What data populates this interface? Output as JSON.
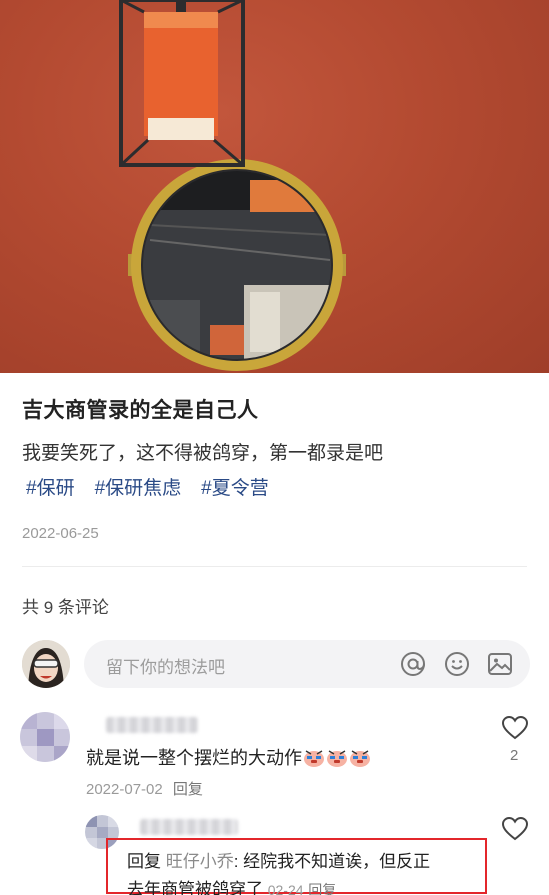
{
  "post": {
    "title": "吉大商管录的全是自己人",
    "text": "我要笑死了，这不得被鸽穿，第一都录是吧",
    "tags": [
      "#保研",
      "#保研焦虑",
      "#夏令营"
    ],
    "date": "2022-06-25"
  },
  "comments_section": {
    "count_label": "共 9 条评论",
    "input_placeholder": "留下你的想法吧",
    "input_icons": [
      "at-icon",
      "emoji-icon",
      "image-icon"
    ]
  },
  "comments": [
    {
      "text": "就是说一整个摆烂的大动作",
      "emoji": "crying-face-icon",
      "date": "2022-07-02",
      "reply_label": "回复",
      "likes": "2"
    }
  ],
  "reply": {
    "prefix": "回复",
    "target_user": "旺仔小乔",
    "text_line1": ": 经院我不知道诶，但反正",
    "text_line2": "去年商管被鸽穿了",
    "date": "02-24",
    "reply_label": "回复"
  },
  "colors": {
    "tag": "#2a4a86",
    "hero_wall": "#b34a31",
    "highlight_border": "#e3262b"
  }
}
